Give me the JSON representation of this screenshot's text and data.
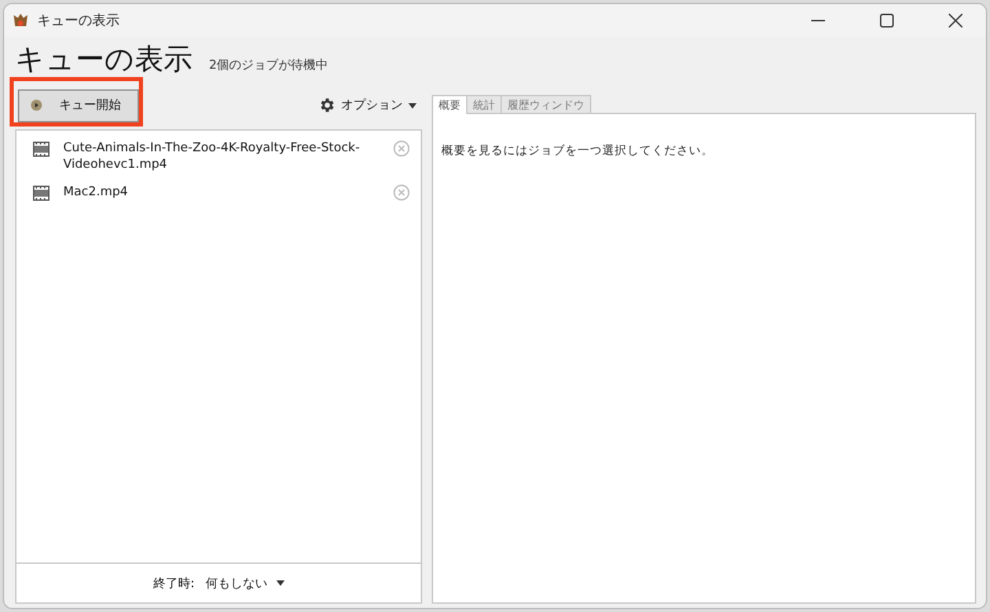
{
  "window": {
    "title": "キューの表示"
  },
  "header": {
    "title": "キューの表示",
    "status": "2個のジョブが待機中"
  },
  "toolbar": {
    "start_button": "キュー開始",
    "highlighted": true,
    "options_menu": "オプション"
  },
  "queue": [
    {
      "name": "Cute-Animals-In-The-Zoo-4K-Royalty-Free-Stock-Videohevc1.mp4"
    },
    {
      "name": "Mac2.mp4"
    }
  ],
  "footer": {
    "label": "終了時:",
    "value": "何もしない"
  },
  "tabs": [
    {
      "label": "概要",
      "selected": true
    },
    {
      "label": "統計",
      "selected": false
    },
    {
      "label": "履歴ウィンドウ",
      "selected": false
    }
  ],
  "summary": {
    "message": "概要を見るにはジョブを一つ選択してください。"
  }
}
